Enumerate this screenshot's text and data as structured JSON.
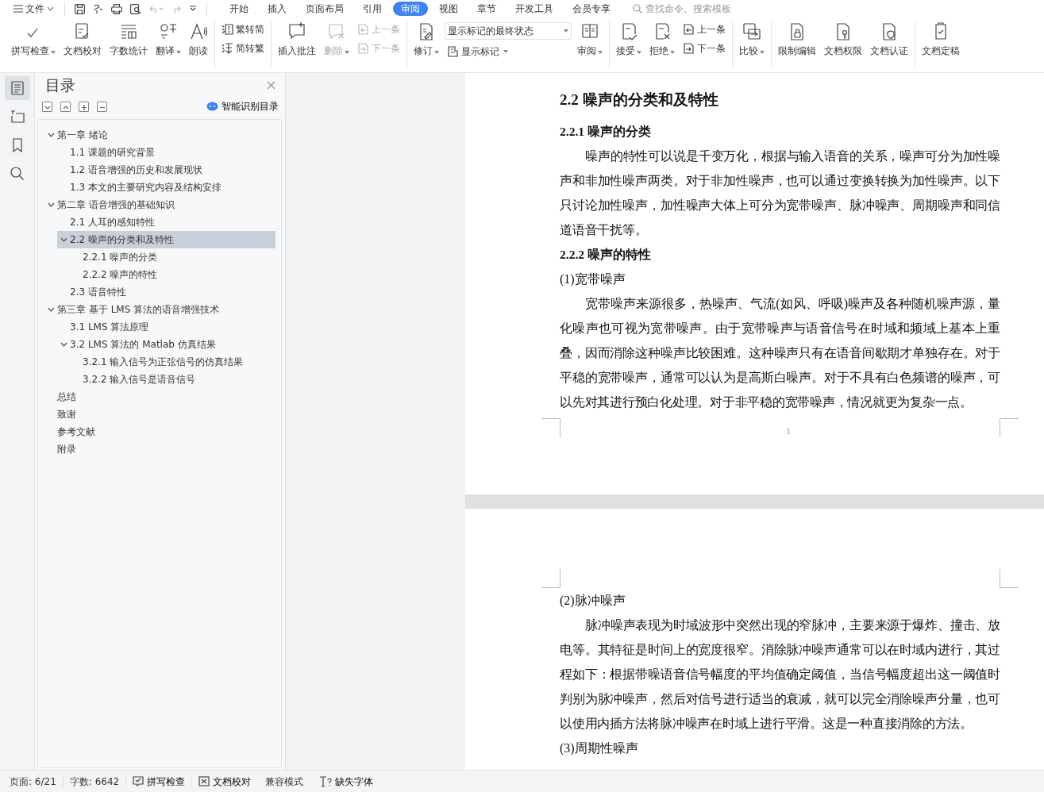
{
  "menu": {
    "file_label": "文件",
    "tabs": [
      {
        "label": "开始",
        "selected": false
      },
      {
        "label": "插入",
        "selected": false
      },
      {
        "label": "页面布局",
        "selected": false
      },
      {
        "label": "引用",
        "selected": false
      },
      {
        "label": "审阅",
        "selected": true
      },
      {
        "label": "视图",
        "selected": false
      },
      {
        "label": "章节",
        "selected": false
      },
      {
        "label": "开发工具",
        "selected": false
      },
      {
        "label": "会员专享",
        "selected": false
      }
    ],
    "search": {
      "placeholder": "查找命令、搜索模板"
    }
  },
  "ribbon": {
    "groups": [
      {
        "items": [
          {
            "kind": "large",
            "label": "拼写检查",
            "caret": true,
            "disabled": false
          },
          {
            "kind": "large",
            "label": "文档校对",
            "caret": false,
            "disabled": false
          },
          {
            "kind": "large",
            "label": "字数统计",
            "caret": false,
            "disabled": false
          },
          {
            "kind": "large",
            "label": "翻译",
            "caret": true,
            "disabled": false
          },
          {
            "kind": "large",
            "label": "朗读",
            "caret": false,
            "disabled": false
          }
        ]
      },
      {
        "items": [
          {
            "kind": "stack",
            "items": [
              {
                "kind": "small",
                "label": "繁转简",
                "caret": false,
                "disabled": false
              },
              {
                "kind": "small",
                "label": "简转繁",
                "caret": false,
                "disabled": false
              }
            ]
          }
        ]
      },
      {
        "items": [
          {
            "kind": "large",
            "label": "插入批注",
            "caret": false,
            "disabled": false
          },
          {
            "kind": "large",
            "label": "删除",
            "caret": true,
            "disabled": true
          },
          {
            "kind": "stack",
            "items": [
              {
                "kind": "small",
                "label": "上一条",
                "caret": false,
                "disabled": true
              },
              {
                "kind": "small",
                "label": "下一条",
                "caret": false,
                "disabled": true
              }
            ]
          }
        ]
      },
      {
        "items": [
          {
            "kind": "large",
            "label": "修订",
            "caret": true,
            "disabled": false
          },
          {
            "kind": "stack",
            "items": [
              {
                "kind": "select",
                "value": "显示标记的最终状态"
              },
              {
                "kind": "small",
                "label": "显示标记",
                "caret": true,
                "disabled": false
              }
            ]
          },
          {
            "kind": "large",
            "label": "审阅",
            "caret": true,
            "disabled": false
          }
        ]
      },
      {
        "items": [
          {
            "kind": "large",
            "label": "接受",
            "caret": true,
            "disabled": false
          },
          {
            "kind": "large",
            "label": "拒绝",
            "caret": true,
            "disabled": false
          },
          {
            "kind": "stack",
            "items": [
              {
                "kind": "small",
                "label": "上一条",
                "caret": false,
                "disabled": false
              },
              {
                "kind": "small",
                "label": "下一条",
                "caret": false,
                "disabled": false
              }
            ]
          }
        ]
      },
      {
        "items": [
          {
            "kind": "large",
            "label": "比较",
            "caret": true,
            "disabled": false
          }
        ]
      },
      {
        "items": [
          {
            "kind": "large",
            "label": "限制编辑",
            "caret": false,
            "disabled": false
          },
          {
            "kind": "large",
            "label": "文档权限",
            "caret": false,
            "disabled": false
          },
          {
            "kind": "large",
            "label": "文档认证",
            "caret": false,
            "disabled": false
          }
        ]
      },
      {
        "items": [
          {
            "kind": "large",
            "label": "文档定稿",
            "caret": false,
            "disabled": false
          }
        ]
      }
    ]
  },
  "side_tools": [
    {
      "selected": true
    },
    {
      "selected": false
    },
    {
      "selected": false
    },
    {
      "selected": false
    }
  ],
  "toc": {
    "title": "目录",
    "smart_label": "智能识别目录",
    "items": [
      {
        "label": "第一章  绪论",
        "expanded": true,
        "selected": false,
        "children": [
          {
            "label": "1.1  课题的研究背景",
            "selected": false
          },
          {
            "label": "1.2  语音增强的历史和发展现状",
            "selected": false
          },
          {
            "label": "1.3  本文的主要研究内容及结构安排",
            "selected": false
          }
        ]
      },
      {
        "label": "第二章  语音增强的基础知识",
        "expanded": true,
        "selected": false,
        "children": [
          {
            "label": "2.1  人耳的感知特性",
            "selected": false
          },
          {
            "label": "2.2  噪声的分类和及特性",
            "expanded": true,
            "selected": true,
            "children": [
              {
                "label": "2.2.1  噪声的分类",
                "selected": false
              },
              {
                "label": "2.2.2  噪声的特性",
                "selected": false
              }
            ]
          },
          {
            "label": "2.3 语音特性",
            "selected": false
          }
        ]
      },
      {
        "label": "第三章  基于 LMS 算法的语音增强技术",
        "expanded": true,
        "selected": false,
        "children": [
          {
            "label": "3.1 LMS 算法原理",
            "selected": false
          },
          {
            "label": "3.2 LMS 算法的 Matlab 仿真结果",
            "expanded": true,
            "selected": false,
            "children": [
              {
                "label": "3.2.1  输入信号为正弦信号的仿真结果",
                "selected": false
              },
              {
                "label": "3.2.2  输入信号是语音信号",
                "selected": false
              }
            ]
          }
        ]
      },
      {
        "label": "总结",
        "selected": false
      },
      {
        "label": "致谢",
        "selected": false
      },
      {
        "label": "参考文献",
        "selected": false
      },
      {
        "label": "附录",
        "selected": false
      }
    ]
  },
  "pages": [
    {
      "blocks": [
        {
          "kind": "h2",
          "text": "2.2  噪声的分类和及特性"
        },
        {
          "kind": "h3",
          "text": "2.2.1  噪声的分类"
        },
        {
          "kind": "para",
          "text": "噪声的特性可以说是千变万化，根据与输入语音的关系，噪声可分为加性噪声和非加性噪声两类。对于非加性噪声，也可以通过变换转换为加性噪声。以下只讨论加性噪声，加性噪声大体上可分为宽带噪声、脉冲噪声、周期噪声和同信道语音干扰等。"
        },
        {
          "kind": "h3",
          "text": "2.2.2  噪声的特性"
        },
        {
          "kind": "line",
          "text": "(1)宽带噪声"
        },
        {
          "kind": "para",
          "text": "宽带噪声来源很多，热噪声、气流(如风、呼吸)噪声及各种随机噪声源，量化噪声也可视为宽带噪声。由于宽带噪声与语音信号在时域和频域上基本上重叠，因而消除这种噪声比较困难。这种噪声只有在语音间歇期才单独存在。对于平稳的宽带噪声，通常可以认为是高斯白噪声。对于不具有白色频谱的噪声，可以先对其进行预白化处理。对于非平稳的宽带噪声，情况就更为复杂一点。"
        }
      ],
      "page_number": "3"
    },
    {
      "blocks": [
        {
          "kind": "line",
          "text": "(2)脉冲噪声"
        },
        {
          "kind": "para",
          "text": "脉冲噪声表现为时域波形中突然出现的窄脉冲，主要来源于爆炸、撞击、放电等。其特征是时间上的宽度很窄。消除脉冲噪声通常可以在时域内进行，其过程如下：根据带噪语音信号幅度的平均值确定阈值，当信号幅度超出这一阈值时判别为脉冲噪声，然后对信号进行适当的衰减，就可以完全消除噪声分量，也可以使用内插方法将脉冲噪声在时域上进行平滑。这是一种直接消除的方法。"
        },
        {
          "kind": "line",
          "text": "(3)周期性噪声"
        }
      ]
    }
  ],
  "status_bar": {
    "page": "页面: 6/21",
    "words": "字数: 6642",
    "spell": "拼写检查",
    "proof": "文档校对",
    "compat": "兼容模式",
    "fonts": "缺失字体"
  }
}
